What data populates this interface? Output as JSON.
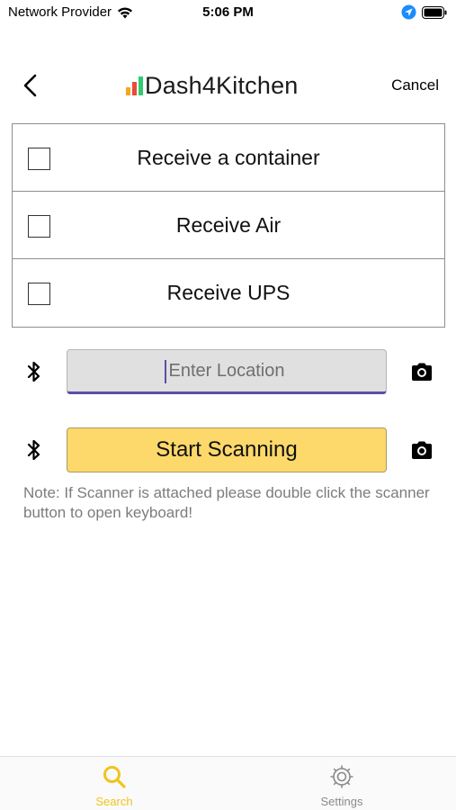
{
  "status_bar": {
    "carrier": "Network Provider",
    "time": "5:06 PM",
    "icons": [
      "wifi-icon",
      "location-arrow-icon",
      "battery-icon"
    ]
  },
  "nav": {
    "back_icon": "chevron-left-icon",
    "app_name": "Dash4Kitchen",
    "logo_bar_colors": [
      "#f5a623",
      "#e74c3c",
      "#2ecc71"
    ],
    "cancel_label": "Cancel"
  },
  "options": [
    {
      "label": "Receive a container",
      "checked": false
    },
    {
      "label": "Receive Air",
      "checked": false
    },
    {
      "label": "Receive UPS",
      "checked": false
    }
  ],
  "location": {
    "placeholder": "Enter Location",
    "value": "",
    "left_icon": "bluetooth-icon",
    "right_icon": "camera-icon"
  },
  "scan": {
    "label": "Start Scanning",
    "left_icon": "bluetooth-icon",
    "right_icon": "camera-icon"
  },
  "note": "Note: If Scanner is attached please double click the scanner button to open keyboard!",
  "tab_bar": {
    "tabs": [
      {
        "label": "Search",
        "icon": "search-icon",
        "active": true
      },
      {
        "label": "Settings",
        "icon": "gear-icon",
        "active": false
      }
    ]
  },
  "colors": {
    "accent_yellow": "#f0c419",
    "scan_button": "#fdd86a",
    "input_underline": "#5b4ea8",
    "inactive_tab": "#8a8a8a"
  }
}
